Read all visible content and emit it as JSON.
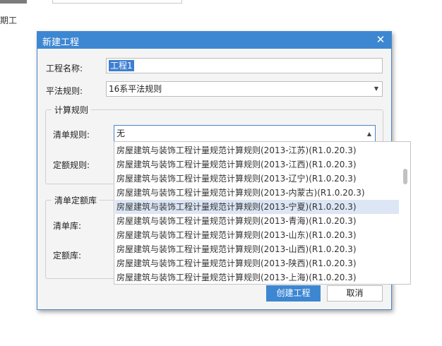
{
  "background": {
    "side_text": "期工"
  },
  "dialog": {
    "title": "新建工程",
    "close_glyph": "✕",
    "project_name_label": "工程名称:",
    "project_name_value": "工程1",
    "rule_label": "平法规则:",
    "rule_value": "16系平法规则",
    "calc_group_title": "计算规则",
    "list_rule_label": "清单规则:",
    "list_rule_value": "无",
    "quota_rule_label": "定额规则:",
    "lib_group_title": "清单定额库",
    "list_lib_label": "清单库:",
    "quota_lib_label": "定额库:",
    "create_button": "创建工程",
    "cancel_button": "取消"
  },
  "dropdown": {
    "items": [
      "房屋建筑与装饰工程计量规范计算规则(2013-江苏)(R1.0.20.3)",
      "房屋建筑与装饰工程计量规范计算规则(2013-江西)(R1.0.20.3)",
      "房屋建筑与装饰工程计量规范计算规则(2013-辽宁)(R1.0.20.3)",
      "房屋建筑与装饰工程计量规范计算规则(2013-内蒙古)(R1.0.20.3)",
      "房屋建筑与装饰工程计量规范计算规则(2013-宁夏)(R1.0.20.3)",
      "房屋建筑与装饰工程计量规范计算规则(2013-青海)(R1.0.20.3)",
      "房屋建筑与装饰工程计量规范计算规则(2013-山东)(R1.0.20.3)",
      "房屋建筑与装饰工程计量规范计算规则(2013-山西)(R1.0.20.3)",
      "房屋建筑与装饰工程计量规范计算规则(2013-陕西)(R1.0.20.3)",
      "房屋建筑与装饰工程计量规范计算规则(2013-上海)(R1.0.20.3)"
    ],
    "highlighted_index": 4
  }
}
